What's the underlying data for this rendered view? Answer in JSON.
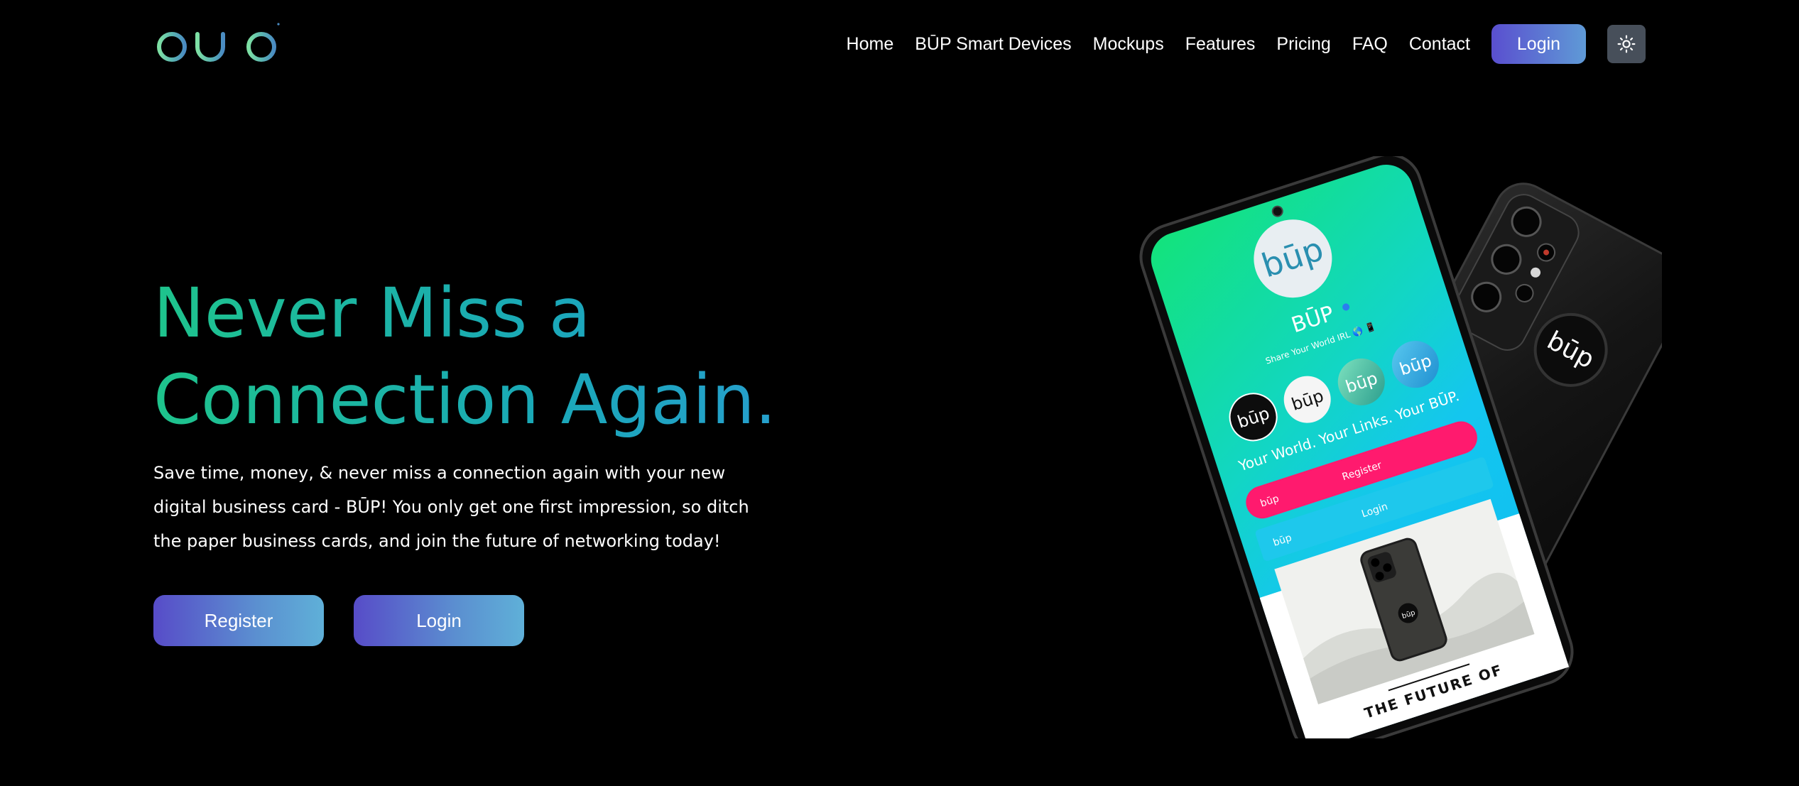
{
  "brand": {
    "logo_text": "būp",
    "logo_icon": "bup-wordmark-logo"
  },
  "nav": {
    "items": [
      {
        "label": "Home"
      },
      {
        "label": "BŪP Smart Devices"
      },
      {
        "label": "Mockups"
      },
      {
        "label": "Features"
      },
      {
        "label": "Pricing"
      },
      {
        "label": "FAQ"
      },
      {
        "label": "Contact"
      }
    ],
    "login_label": "Login",
    "theme_icon": "sun-icon"
  },
  "hero": {
    "title_line1": "Never Miss a",
    "title_line2": "Connection Again.",
    "description": "Save time, money, & never miss a connection again with your new digital business card - BŪP! You only get one first impression, so ditch the paper business cards, and join the future of networking today!",
    "register_label": "Register",
    "login_label": "Login"
  },
  "phone_screen": {
    "profile_name": "BŪP",
    "profile_tagline": "Share Your World IRL 🌎 📱",
    "headline": "Your World. Your Links. Your BŪP.",
    "register_label": "Register",
    "login_label": "Login",
    "mini_logo": "būp",
    "banner_text": "THE FUTURE OF"
  },
  "colors": {
    "accent_gradient_start": "#5a4fcf",
    "accent_gradient_end": "#5f9ad6",
    "title_gradient_start": "#1ec48c",
    "title_gradient_end": "#2a9cd4",
    "background": "#000000",
    "theme_toggle_bg": "#474f5a",
    "phone_register_pink": "#ff1a6e",
    "phone_login_cyan": "#1ec8ec"
  }
}
